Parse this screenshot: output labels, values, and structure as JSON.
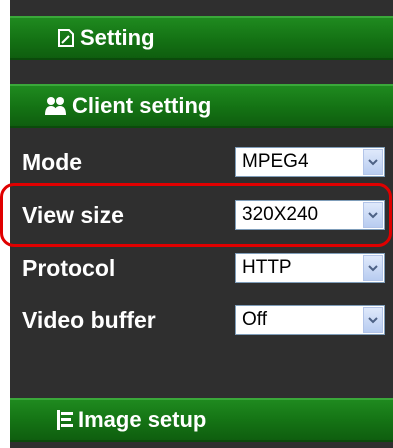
{
  "menu": {
    "setting_label": "Setting",
    "client_setting_label": "Client setting",
    "image_setup_label": "Image setup"
  },
  "client_settings": {
    "mode": {
      "label": "Mode",
      "value": "MPEG4"
    },
    "view_size": {
      "label": "View size",
      "value": "320X240"
    },
    "protocol": {
      "label": "Protocol",
      "value": "HTTP"
    },
    "video_buffer": {
      "label": "Video buffer",
      "value": "Off"
    }
  },
  "icons": {
    "setting": "document-edit-icon",
    "client_setting": "users-icon",
    "image_setup": "image-setup-icon",
    "dropdown": "chevron-down-icon"
  },
  "colors": {
    "panel_bg": "#2f2f2f",
    "menu_bar": "#147214",
    "highlight": "#e00000"
  }
}
